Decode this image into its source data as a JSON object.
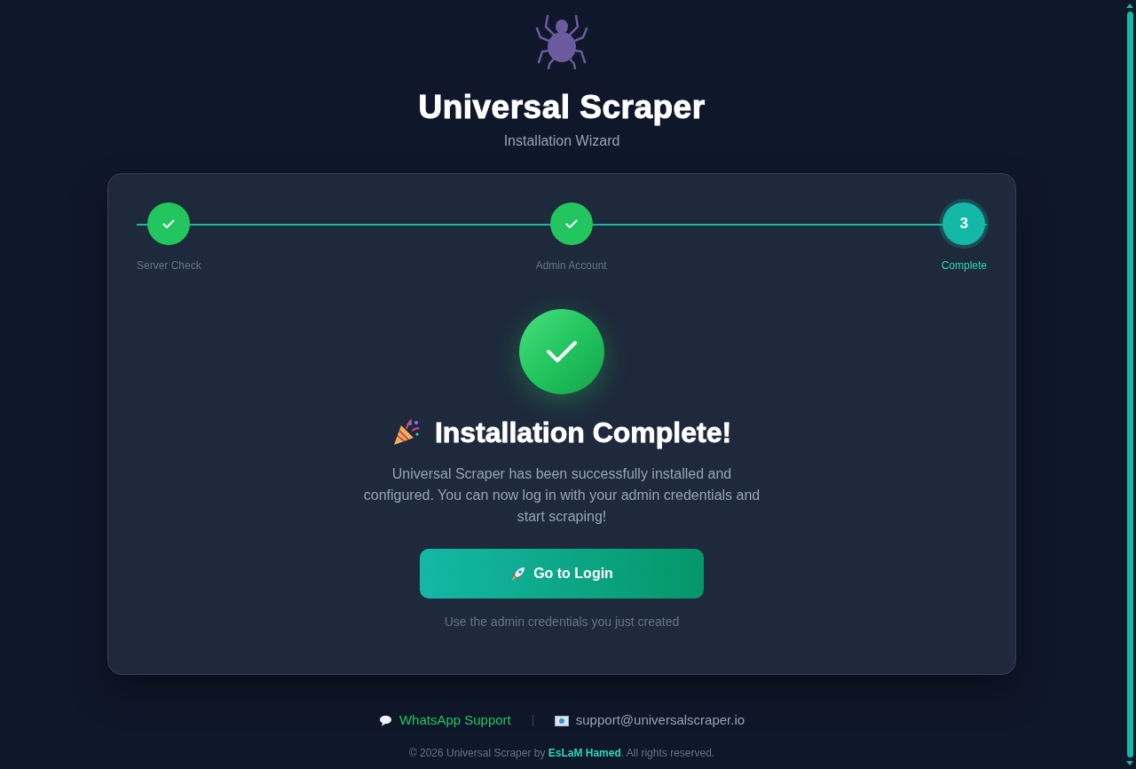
{
  "header": {
    "title": "Universal Scraper",
    "subtitle": "Installation Wizard"
  },
  "steps": [
    {
      "label": "Server Check",
      "completed": true,
      "selected": false
    },
    {
      "label": "Admin Account",
      "completed": true,
      "selected": false
    },
    {
      "label": "Complete",
      "completed": false,
      "selected": true,
      "number": "3"
    }
  ],
  "success": {
    "title": "Installation Complete!",
    "message": "Universal Scraper has been successfully installed and configured. You can now log in with your admin credentials and start scraping!",
    "button": "Go to Login",
    "hint": "Use the admin credentials you just created"
  },
  "footer": {
    "whatsapp": "WhatsApp Support",
    "email": "support@universalscraper.io",
    "copyright_before": "© 2026 Universal Scraper by ",
    "author": "EsLaM Hamed",
    "copyright_after": ". All rights reserved."
  }
}
